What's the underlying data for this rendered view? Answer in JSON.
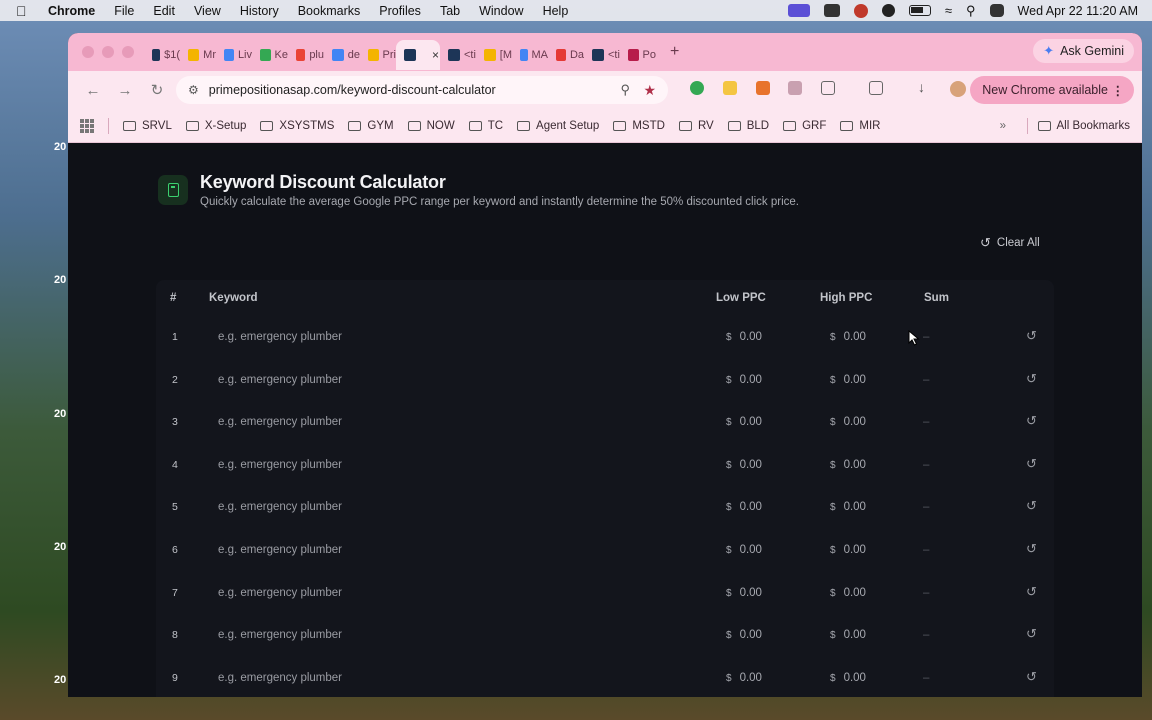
{
  "menubar": {
    "app": "Chrome",
    "items": [
      "File",
      "Edit",
      "View",
      "History",
      "Bookmarks",
      "Profiles",
      "Tab",
      "Window",
      "Help"
    ],
    "clock": "Wed Apr 22  11:20 AM"
  },
  "wallpaper_labels": [
    "20",
    "20",
    "20",
    "20",
    "20"
  ],
  "tabs": [
    {
      "label": "$1(",
      "color": "#1d3557"
    },
    {
      "label": "Mr",
      "color": "#f4b400"
    },
    {
      "label": "Liv",
      "color": "#4285f4"
    },
    {
      "label": "Ke",
      "color": "#34a853"
    },
    {
      "label": "plu",
      "color": "#ea4335"
    },
    {
      "label": "de",
      "color": "#4285f4"
    },
    {
      "label": "Pri",
      "color": "#f4b400"
    },
    {
      "label": "",
      "color": "#1d3557",
      "active": true
    },
    {
      "label": "<ti",
      "color": "#1d3557"
    },
    {
      "label": "[M",
      "color": "#f4b400"
    },
    {
      "label": "MA",
      "color": "#4285f4"
    },
    {
      "label": "Da",
      "color": "#e53935"
    },
    {
      "label": "<ti",
      "color": "#1d3557"
    },
    {
      "label": "Po",
      "color": "#b71c4a"
    }
  ],
  "gemini_label": "Ask Gemini",
  "address": "primepositionasap.com/keyword-discount-calculator",
  "new_chrome_label": "New Chrome available",
  "bookmarks": [
    "SRVL",
    "X-Setup",
    "XSYSTMS",
    "GYM",
    "NOW",
    "TC",
    "Agent Setup",
    "MSTD",
    "RV",
    "BLD",
    "GRF",
    "MIR"
  ],
  "bookmarks_more": "»",
  "all_bookmarks": "All Bookmarks",
  "page": {
    "title": "Keyword Discount Calculator",
    "subtitle": "Quickly calculate the average Google PPC range per keyword and instantly determine the 50% discounted click price.",
    "clear_all": "Clear All",
    "columns": {
      "num": "#",
      "keyword": "Keyword",
      "low": "Low PPC",
      "high": "High PPC",
      "sum": "Sum"
    },
    "currency": "$",
    "rows": [
      {
        "num": "1",
        "placeholder": "e.g. emergency plumber",
        "low": "0.00",
        "high": "0.00",
        "sum": "–"
      },
      {
        "num": "2",
        "placeholder": "e.g. emergency plumber",
        "low": "0.00",
        "high": "0.00",
        "sum": "–"
      },
      {
        "num": "3",
        "placeholder": "e.g. emergency plumber",
        "low": "0.00",
        "high": "0.00",
        "sum": "–"
      },
      {
        "num": "4",
        "placeholder": "e.g. emergency plumber",
        "low": "0.00",
        "high": "0.00",
        "sum": "–"
      },
      {
        "num": "5",
        "placeholder": "e.g. emergency plumber",
        "low": "0.00",
        "high": "0.00",
        "sum": "–"
      },
      {
        "num": "6",
        "placeholder": "e.g. emergency plumber",
        "low": "0.00",
        "high": "0.00",
        "sum": "–"
      },
      {
        "num": "7",
        "placeholder": "e.g. emergency plumber",
        "low": "0.00",
        "high": "0.00",
        "sum": "–"
      },
      {
        "num": "8",
        "placeholder": "e.g. emergency plumber",
        "low": "0.00",
        "high": "0.00",
        "sum": "–"
      },
      {
        "num": "9",
        "placeholder": "e.g. emergency plumber",
        "low": "0.00",
        "high": "0.00",
        "sum": "–"
      }
    ]
  },
  "colors": {
    "accent": "#3bd16f",
    "tabstrip": "#f7b8d2",
    "page_bg": "#0f1117"
  }
}
